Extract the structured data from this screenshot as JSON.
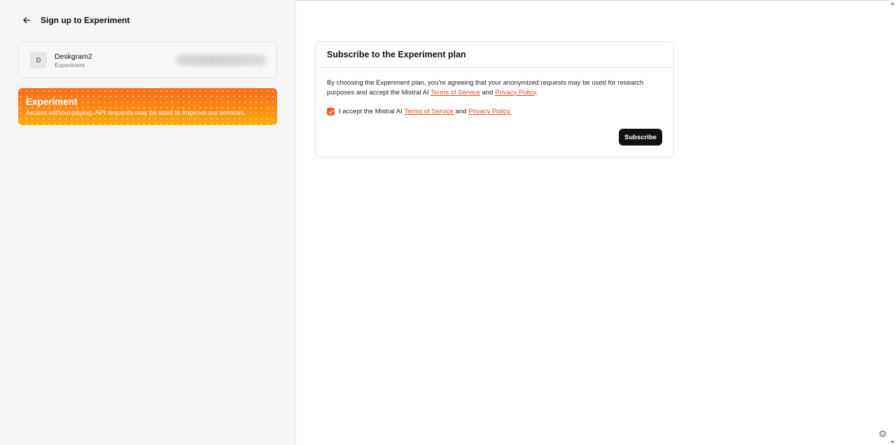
{
  "header": {
    "back_icon": "arrow-left-icon",
    "title": "Sign up to Experiment"
  },
  "account": {
    "avatar_letter": "D",
    "name": "Deskgram2",
    "plan": "Experiment",
    "email_state": "blurred"
  },
  "plan_card": {
    "title": "Experiment",
    "description": "Access without paying. API requests may be used to improve our services.",
    "gradient_colors": [
      "#fb6a1c",
      "#ffad10"
    ]
  },
  "subscribe_panel": {
    "title": "Subscribe to the Experiment plan",
    "body_prefix": "By choosing the Experiment plan, you're agreeing that your anonymized requests may be used for research purposes and accept the Mistral AI ",
    "terms_link": "Terms of Service",
    "and_text": " and ",
    "privacy_link": "Privacy Policy",
    "body_suffix": ".",
    "accept_prefix": "I accept the Mistral AI ",
    "accept_terms_link": "Terms of Service",
    "accept_and": " and ",
    "accept_privacy_link": "Privacy Policy.",
    "accepted": true,
    "subscribe_label": "Subscribe"
  },
  "colors": {
    "accent": "#f15a22",
    "link": "#e2491b",
    "button_bg": "#111111",
    "sidebar_bg": "#f5f5f4"
  }
}
